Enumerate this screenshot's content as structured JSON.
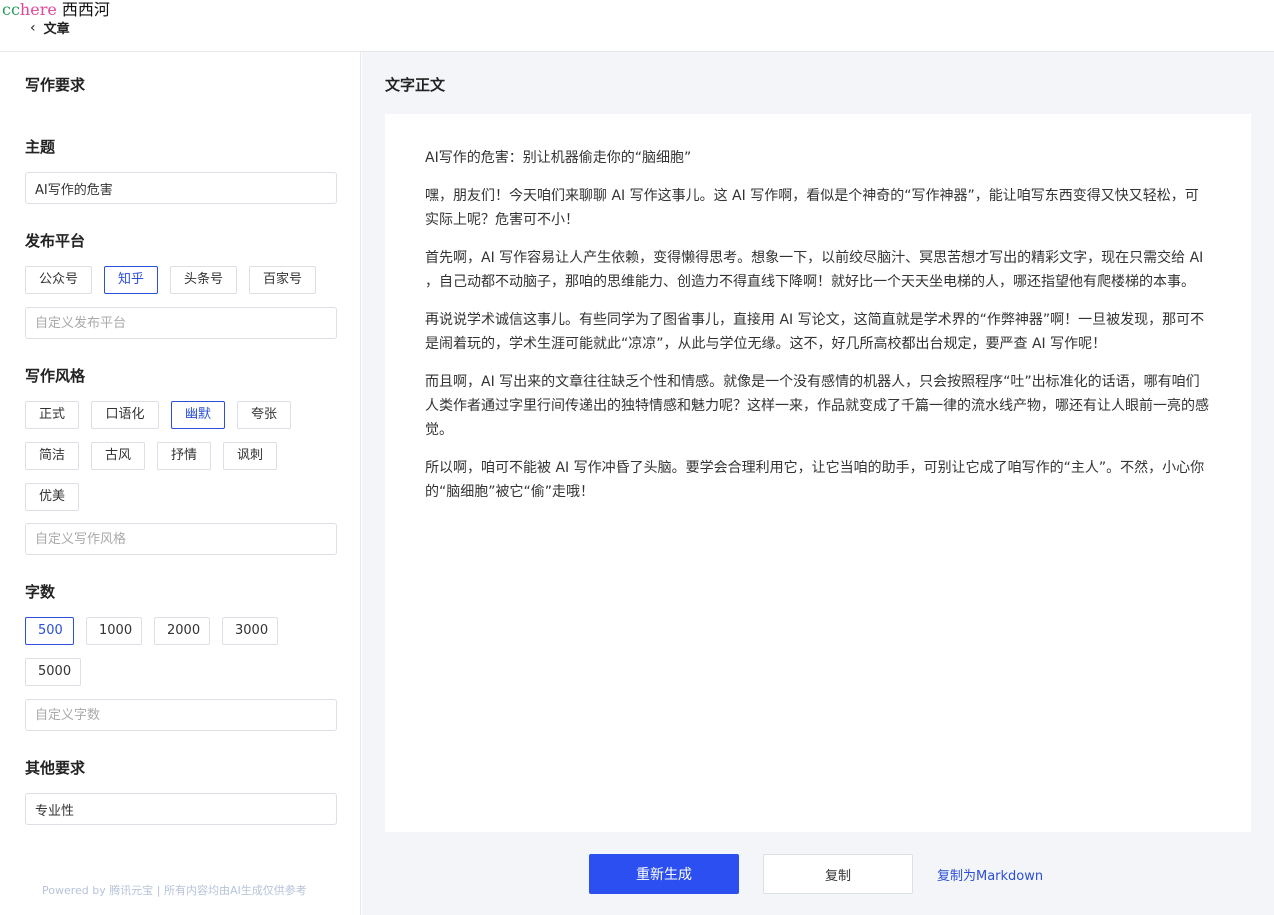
{
  "watermark": {
    "cc": "cc",
    "here": "here",
    "xi": "西西河"
  },
  "header": {
    "back_label": "文章",
    "back_icon": "chevron-left-icon"
  },
  "left": {
    "title": "写作要求",
    "topic": {
      "label": "主题",
      "value": "AI写作的危害"
    },
    "platform": {
      "label": "发布平台",
      "options": [
        "公众号",
        "知乎",
        "头条号",
        "百家号"
      ],
      "selected": "知乎",
      "custom_placeholder": "自定义发布平台"
    },
    "style": {
      "label": "写作风格",
      "options_row1": [
        "正式",
        "口语化",
        "幽默",
        "夸张"
      ],
      "options_row2": [
        "简洁",
        "古风",
        "抒情",
        "讽刺"
      ],
      "options_row3": [
        "优美"
      ],
      "selected": "幽默",
      "custom_placeholder": "自定义写作风格"
    },
    "wordcount": {
      "label": "字数",
      "options_row1": [
        "500",
        "1000",
        "2000",
        "3000"
      ],
      "options_row2": [
        "5000"
      ],
      "selected": "500",
      "custom_placeholder": "自定义字数"
    },
    "other": {
      "label": "其他要求",
      "value": "专业性"
    },
    "footer": "Powered by 腾讯元宝 | 所有内容均由AI生成仅供参考"
  },
  "right": {
    "title": "文字正文",
    "article": {
      "headline": "AI写作的危害：别让机器偷走你的“脑细胞”",
      "paragraphs": [
        "嘿，朋友们！今天咱们来聊聊 AI 写作这事儿。这 AI 写作啊，看似是个神奇的“写作神器”，能让咱写东西变得又快又轻松，可实际上呢？危害可不小！",
        "首先啊，AI 写作容易让人产生依赖，变得懒得思考。想象一下，以前绞尽脑汁、冥思苦想才写出的精彩文字，现在只需交给 AI ，自己动都不动脑子，那咱的思维能力、创造力不得直线下降啊！就好比一个天天坐电梯的人，哪还指望他有爬楼梯的本事。",
        "再说说学术诚信这事儿。有些同学为了图省事儿，直接用 AI 写论文，这简直就是学术界的“作弊神器”啊！一旦被发现，那可不是闹着玩的，学术生涯可能就此“凉凉”，从此与学位无缘。这不，好几所高校都出台规定，要严查 AI 写作呢！",
        "而且啊，AI 写出来的文章往往缺乏个性和情感。就像是一个没有感情的机器人，只会按照程序“吐”出标准化的话语，哪有咱们人类作者通过字里行间传递出的独特情感和魅力呢？这样一来，作品就变成了千篇一律的流水线产物，哪还有让人眼前一亮的感觉。",
        "所以啊，咱可不能被 AI 写作冲昏了头脑。要学会合理利用它，让它当咱的助手，可别让它成了咱写作的“主人”。不然，小心你的“脑细胞”被它“偷”走哦！"
      ]
    },
    "actions": {
      "regenerate": "重新生成",
      "copy": "复制",
      "copy_markdown": "复制为Markdown"
    }
  }
}
